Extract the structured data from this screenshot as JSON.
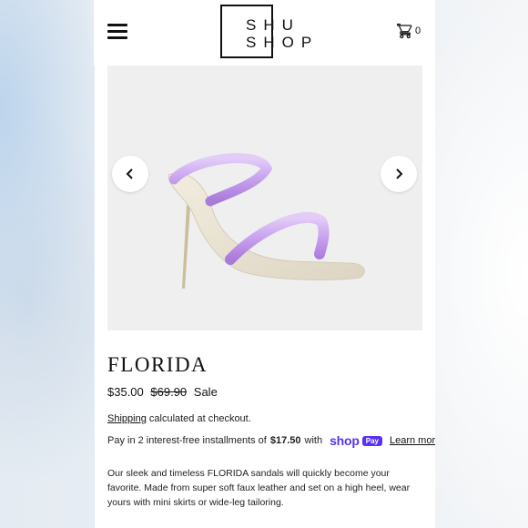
{
  "header": {
    "logo_line1": "SHU",
    "logo_line2": "SHOP",
    "cart_count": "0",
    "menu_icon": "hamburger-menu-icon",
    "cart_icon": "shopping-cart-icon"
  },
  "gallery": {
    "prev_icon": "chevron-left-icon",
    "next_icon": "chevron-right-icon"
  },
  "product": {
    "title": "FLORIDA",
    "price": "$35.00",
    "compare_price": "$69.90",
    "sale_label": "Sale",
    "shipping_link": "Shipping",
    "shipping_text": " calculated at checkout.",
    "installments_prefix": "Pay in 2 interest-free installments of",
    "installment_amount": "$17.50",
    "installments_suffix": "with",
    "shop_word": "shop",
    "pay_badge": "Pay",
    "learn_more": "Learn more",
    "description": "Our sleek and timeless FLORIDA sandals will quickly become your favorite. Made from super soft faux leather and set on a high heel, wear yours with mini skirts or wide-leg tailoring."
  },
  "colors": {
    "shop_pay_purple": "#5a31f4",
    "strap_lilac": "#c9a7ef",
    "sole_cream": "#ece6d6"
  }
}
